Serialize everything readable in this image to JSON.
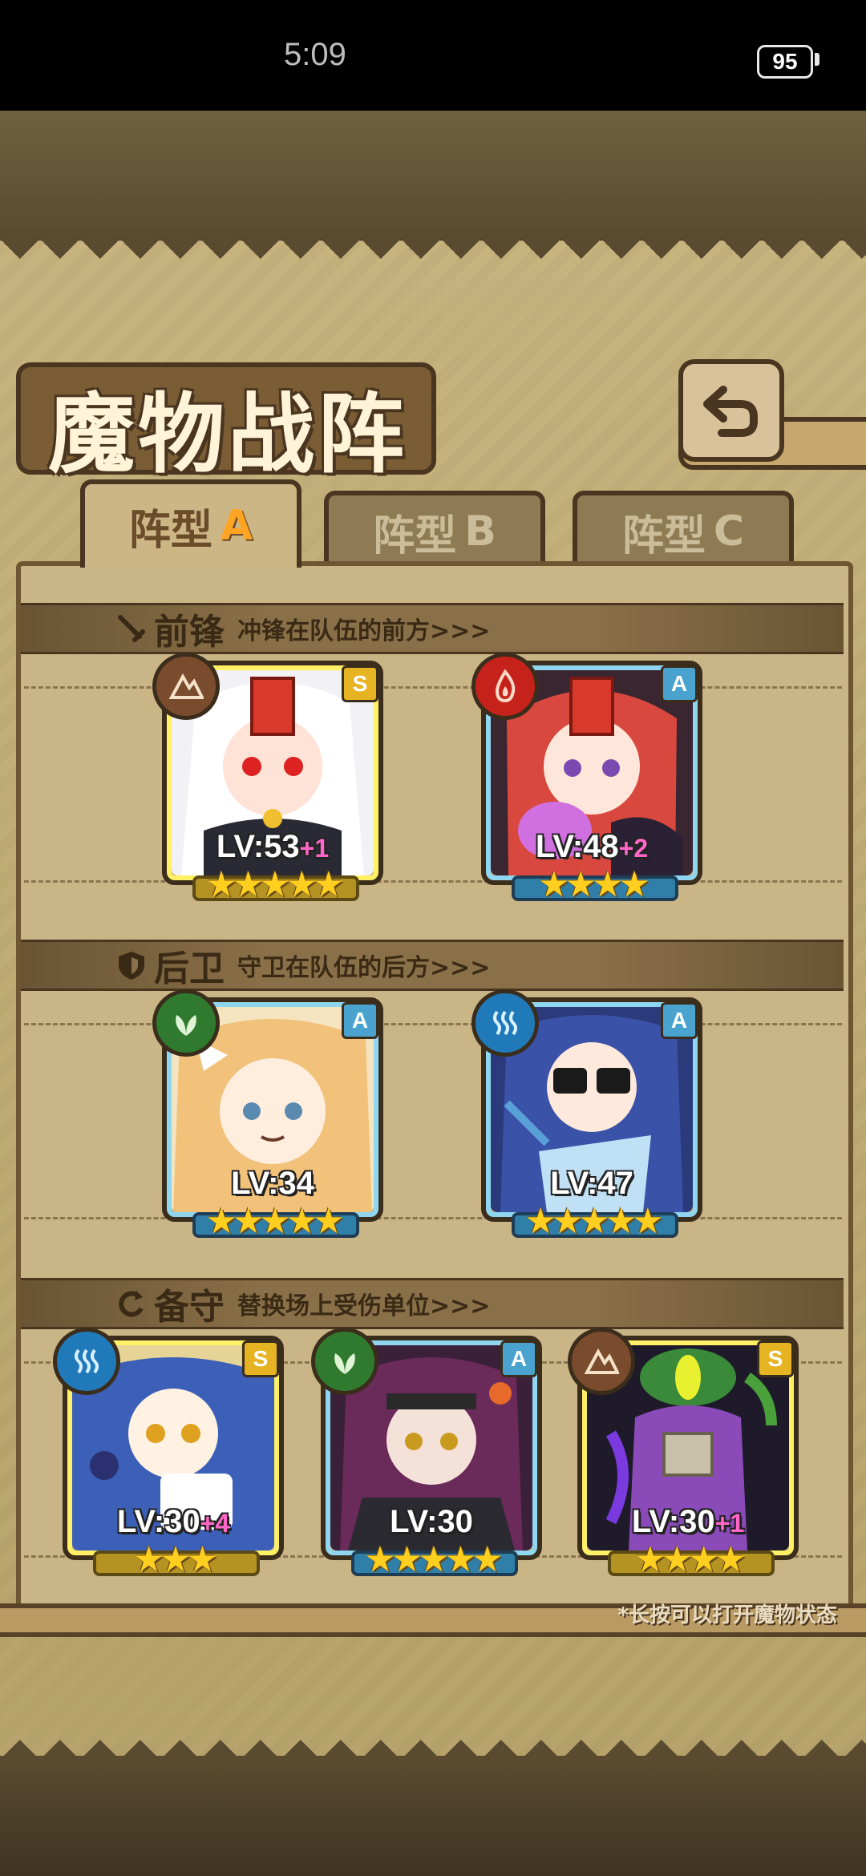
{
  "status_bar": {
    "time": "5:09",
    "battery": "95"
  },
  "header": {
    "title": "魔物战阵",
    "back_icon": "back-arrow-icon"
  },
  "tabs": [
    {
      "label": "阵型",
      "letter": "A",
      "active": true
    },
    {
      "label": "阵型",
      "letter": "B",
      "active": false
    },
    {
      "label": "阵型",
      "letter": "C",
      "active": false
    }
  ],
  "sections": {
    "front": {
      "title": "前锋",
      "desc": "冲锋在队伍的前方>>>"
    },
    "back": {
      "title": "后卫",
      "desc": "守卫在队伍的后方>>>"
    },
    "reserve": {
      "title": "备守",
      "desc": "替换场上受伤单位>>>"
    }
  },
  "cards": [
    {
      "level": "LV:53",
      "plus": "+1",
      "rank": "S",
      "element": "earth",
      "stars": "★★★★★"
    },
    {
      "level": "LV:48",
      "plus": "+2",
      "rank": "A",
      "element": "fire",
      "stars": "★★★★"
    },
    {
      "level": "LV:34",
      "plus": "",
      "rank": "A",
      "element": "wood",
      "stars": "★★★★★"
    },
    {
      "level": "LV:47",
      "plus": "",
      "rank": "A",
      "element": "water",
      "stars": "★★★★★"
    },
    {
      "level": "LV:30",
      "plus": "+4",
      "rank": "S",
      "element": "water",
      "stars": "★★★"
    },
    {
      "level": "LV:30",
      "plus": "",
      "rank": "A",
      "element": "wood",
      "stars": "★★★★★"
    },
    {
      "level": "LV:30",
      "plus": "+1",
      "rank": "S",
      "element": "earth",
      "stars": "★★★★"
    }
  ],
  "footnote": "*长按可以打开魔物状态",
  "colors": {
    "paper": "#c7b37e",
    "frame": "#4a3520",
    "rank_s": "#e6b423",
    "rank_a": "#4aa3cf",
    "plus": "#ff66c8"
  }
}
